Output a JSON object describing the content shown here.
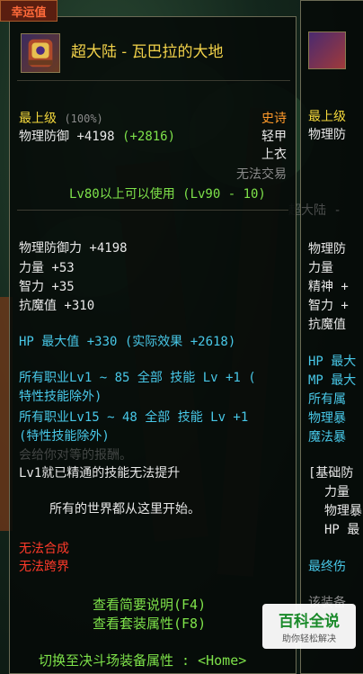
{
  "corner_tab": "幸运值",
  "item": {
    "name": "超大陆 - 瓦巴拉的大地",
    "grade": "最上级",
    "grade_pct": "(100%)",
    "rarity": "史诗",
    "defense_line_label": "物理防御",
    "defense_line_value": "+4198",
    "defense_line_bonus": "(+2816)",
    "armor_type": "轻甲",
    "slot": "上衣",
    "trade": "无法交易",
    "level_req": "Lv80以上可以使用 (Lv90 - 10)"
  },
  "stats": [
    {
      "text": "物理防御力 +4198"
    },
    {
      "text": "力量 +53"
    },
    {
      "text": "智力 +35"
    },
    {
      "text": "抗魔值 +310"
    }
  ],
  "hp_line": "HP 最大值 +330 (实际效果 +2618)",
  "skill_lines": [
    "所有职业Lv1 ~ 85 全部 技能 Lv +1 (",
    "特性技能除外)",
    "所有职业Lv15 ~ 48 全部 技能 Lv +1",
    "(特性技能除外)"
  ],
  "faded_text": "会给你对等的报酬。",
  "skill_note": "Lv1就已精通的技能无法提升",
  "flavor": "所有的世界都从这里开始。",
  "restrictions": [
    "无法合成",
    "无法跨界"
  ],
  "links": [
    "查看简要说明(F4)",
    "查看套装属性(F8)"
  ],
  "switch_hint": "切换至决斗场装备属性 : <Home>",
  "second_panel": {
    "grade": "最上级",
    "defense": "物理防",
    "ghost_name": "超大陆 -",
    "stats": [
      "物理防",
      "力量",
      "精神 +",
      "智力 +",
      "抗魔值"
    ],
    "stats2": [
      "HP 最大",
      "MP 最大",
      "所有属",
      "物理暴",
      "魔法暴"
    ],
    "box": [
      "[基础防",
      "力量",
      "物理暴",
      "HP 最"
    ],
    "final": "最终伤",
    "note": "该装备"
  },
  "watermark": {
    "main": "百科全说",
    "sub": "助你轻松解决"
  },
  "colors": {
    "yellow": "#f4d83c",
    "green": "#7ee24a",
    "cyan": "#48c8e8",
    "red": "#ff3a2a",
    "orange": "#ff9a2a"
  }
}
